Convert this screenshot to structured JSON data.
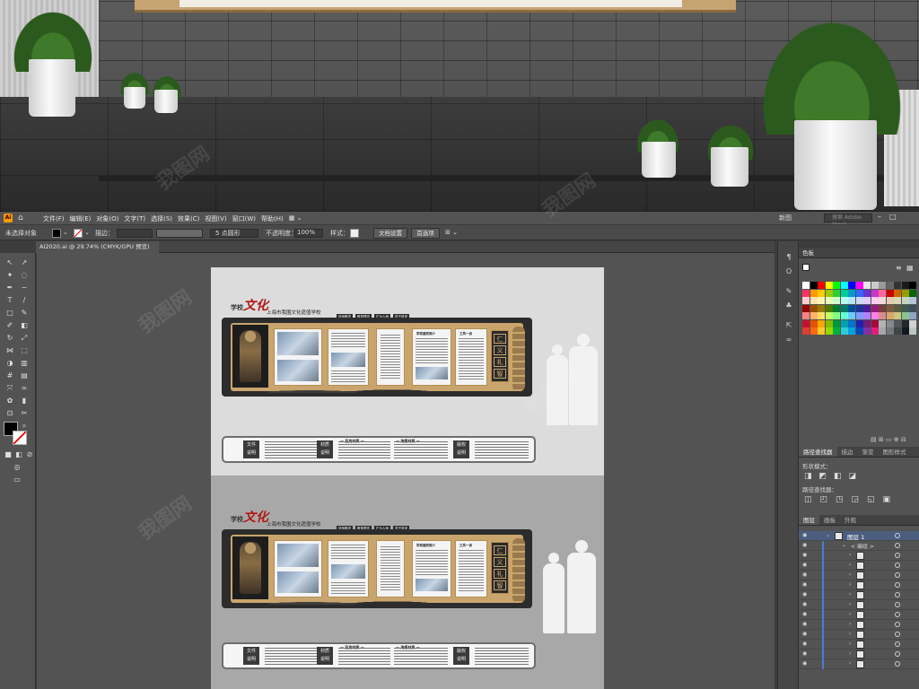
{
  "app": {
    "logo": "Ai",
    "tab_title": "AI2020.ai @ 29.74% (CMYK/GPU 预览)"
  },
  "menu": [
    "文件(F)",
    "编辑(E)",
    "对象(O)",
    "文字(T)",
    "选择(S)",
    "效果(C)",
    "视图(V)",
    "窗口(W)",
    "帮助(H)"
  ],
  "workspace": "新图",
  "search_placeholder": "搜索 Adobe Stock",
  "control_bar": {
    "selection_label": "未选择对象",
    "stroke_label": "描边：",
    "brush_label": "5 点圆形",
    "opacity_label": "不透明度：",
    "opacity_value": "100%",
    "style_label": "样式：",
    "doc_setup": "文档设置",
    "preferences": "首选项"
  },
  "panels": {
    "swatches_title": "色板",
    "pathfinder_tabs": [
      "路径查找器",
      "描边",
      "渐变",
      "图形样式"
    ],
    "shape_modes_label": "形状模式：",
    "pathfinders_label": "路径查找器：",
    "layers_tabs": [
      "图层",
      "画板",
      "外观"
    ],
    "layer_name": "图层 1",
    "group_name": "< 编组 >"
  },
  "swatch_colors": [
    "#ffffff",
    "#000000",
    "#ff0000",
    "#ffff00",
    "#00ff00",
    "#00ffff",
    "#0000ff",
    "#ff00ff",
    "#e6e6e6",
    "#cccccc",
    "#999999",
    "#666666",
    "#333333",
    "#1a1a1a",
    "#000000",
    "#ff3366",
    "#ff9900",
    "#ffcc00",
    "#99cc00",
    "#33cc33",
    "#00cc99",
    "#0099cc",
    "#3366ff",
    "#6633cc",
    "#cc33cc",
    "#ff6699",
    "#cc0000",
    "#cc6600",
    "#999900",
    "#006600",
    "#ffcccc",
    "#ffe0b3",
    "#fff5b3",
    "#e6ffb3",
    "#ccffcc",
    "#b3fff0",
    "#b3e6ff",
    "#ccd9ff",
    "#e0ccff",
    "#ffccf2",
    "#f2d9d9",
    "#e6ccb3",
    "#d9d9b3",
    "#c2d6c2",
    "#b3c6d9",
    "#990000",
    "#994d00",
    "#997a00",
    "#4d7a00",
    "#007a33",
    "#007a66",
    "#004d99",
    "#1a3399",
    "#4d1a99",
    "#991a7a",
    "#7a3d3d",
    "#7a5c3d",
    "#5c5c3d",
    "#3d5c4d",
    "#3d4d5c",
    "#ff8080",
    "#ffb366",
    "#ffe066",
    "#c2ff66",
    "#80ff80",
    "#66ffd9",
    "#66ccff",
    "#8099ff",
    "#b380ff",
    "#ff80e6",
    "#d98c8c",
    "#d9a66b",
    "#c9c97a",
    "#8cc28c",
    "#8ca6c9",
    "#c8102e",
    "#e35205",
    "#f2a900",
    "#84bd00",
    "#009639",
    "#00a3ad",
    "#0072ce",
    "#1e22aa",
    "#6d2077",
    "#a6093d",
    "#b2b4b2",
    "#888b8d",
    "#53565a",
    "#25282a",
    "#d0d3d4",
    "#e03c31",
    "#ff6a13",
    "#ffc72c",
    "#97d700",
    "#00b140",
    "#2dccd3",
    "#00a3e0",
    "#0047bb",
    "#8031a7",
    "#e31c79",
    "#a4a9ad",
    "#75787b",
    "#3f4444",
    "#101820",
    "#bec6c4"
  ],
  "design": {
    "title_a": "学校",
    "title_b": "文化",
    "subtitle": "上海市我围文化遗值学校",
    "tags": [
      "信师概述",
      "教育理念",
      "忙为人师",
      "学子风采"
    ],
    "motto": [
      "仁",
      "义",
      "礼",
      "智",
      "信"
    ],
    "panel_heads": [
      "学校建校简介",
      "三风一训"
    ],
    "strip_labels": [
      "文件\n说明",
      "材质\n说明",
      "版权\n说明"
    ],
    "strip_heads": [
      "— 亚克材质 —",
      "— 海报材质 —"
    ]
  },
  "watermark": "我图网"
}
